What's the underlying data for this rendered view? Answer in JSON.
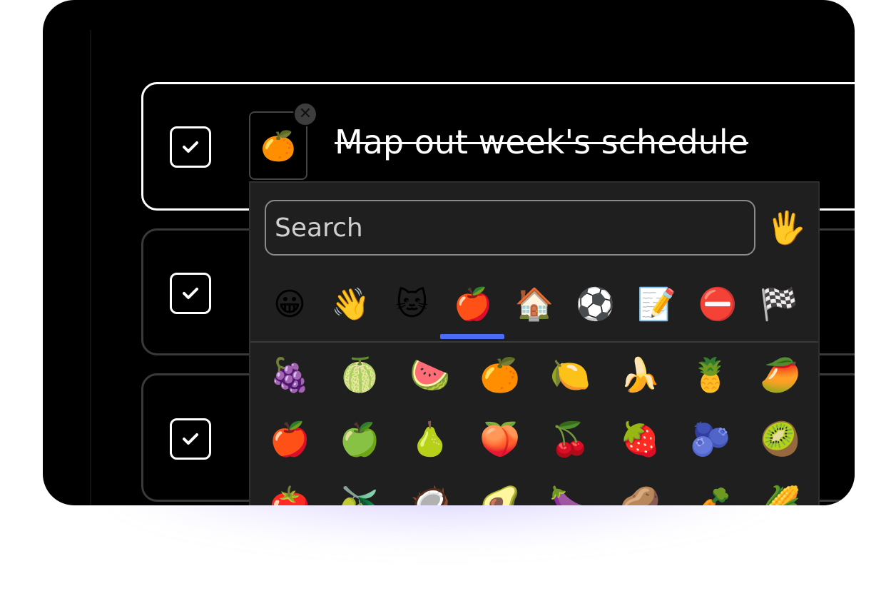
{
  "task": {
    "title": "Map out week's schedule",
    "emoji": "🍊",
    "remove_glyph": "✕"
  },
  "picker": {
    "search_placeholder": "Search",
    "skin_tone": "🖐️",
    "categories": [
      "😀",
      "👋",
      "🐱",
      "🍎",
      "🏠",
      "⚽",
      "📝",
      "⛔",
      "🏁"
    ],
    "active_category_index": 3,
    "emojis": [
      "🍇",
      "🍈",
      "🍉",
      "🍊",
      "🍋",
      "🍌",
      "🍍",
      "🥭",
      "🍎",
      "🍏",
      "🍐",
      "🍑",
      "🍒",
      "🍓",
      "🫐",
      "🥝",
      "🍅",
      "🫒",
      "🥥",
      "🥑",
      "🍆",
      "🥔",
      "🥕",
      "🌽"
    ]
  },
  "colors": {
    "accent": "#4a6cf7",
    "background": "#000000",
    "panel": "#1f1f1f"
  }
}
